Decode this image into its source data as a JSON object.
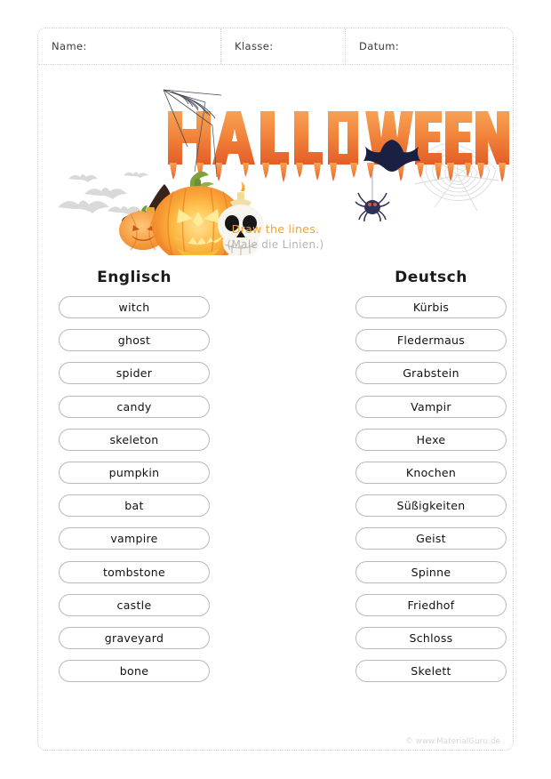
{
  "header": {
    "name_label": "Name:",
    "class_label": "Klasse:",
    "date_label": "Datum:"
  },
  "logo": {
    "title_text": "HALLOWEEN",
    "icons": [
      "spider-web-icon",
      "bat-icon",
      "spider-icon",
      "jack-o-lantern-icon",
      "small-pumpkin-icon",
      "witch-hat-icon",
      "skull-icon",
      "candle-icon"
    ]
  },
  "decorations": {
    "left": "flying-bats-decoration",
    "right": "spider-web-decoration"
  },
  "instructions": {
    "english": "Draw the lines.",
    "german": "(Male die Linien.)"
  },
  "columns": {
    "left_heading": "Englisch",
    "right_heading": "Deutsch",
    "english_words": [
      "witch",
      "ghost",
      "spider",
      "candy",
      "skeleton",
      "pumpkin",
      "bat",
      "vampire",
      "tombstone",
      "castle",
      "graveyard",
      "bone"
    ],
    "german_words": [
      "Kürbis",
      "Fledermaus",
      "Grabstein",
      "Vampir",
      "Hexe",
      "Knochen",
      "Süßigkeiten",
      "Geist",
      "Spinne",
      "Friedhof",
      "Schloss",
      "Skelett"
    ]
  },
  "footer": {
    "copyright": "© www.MaterialGuru.de"
  },
  "colors": {
    "title_orange_light": "#f5903f",
    "title_orange_dark": "#e35d27",
    "instruction_orange": "#f0a430",
    "instruction_gray": "#b4b4b4",
    "bat_navy": "#1a1f3d",
    "border_gray": "#b9b9b9",
    "page_border": "#cfcfcf",
    "footer_gray": "#d6d6d6"
  }
}
